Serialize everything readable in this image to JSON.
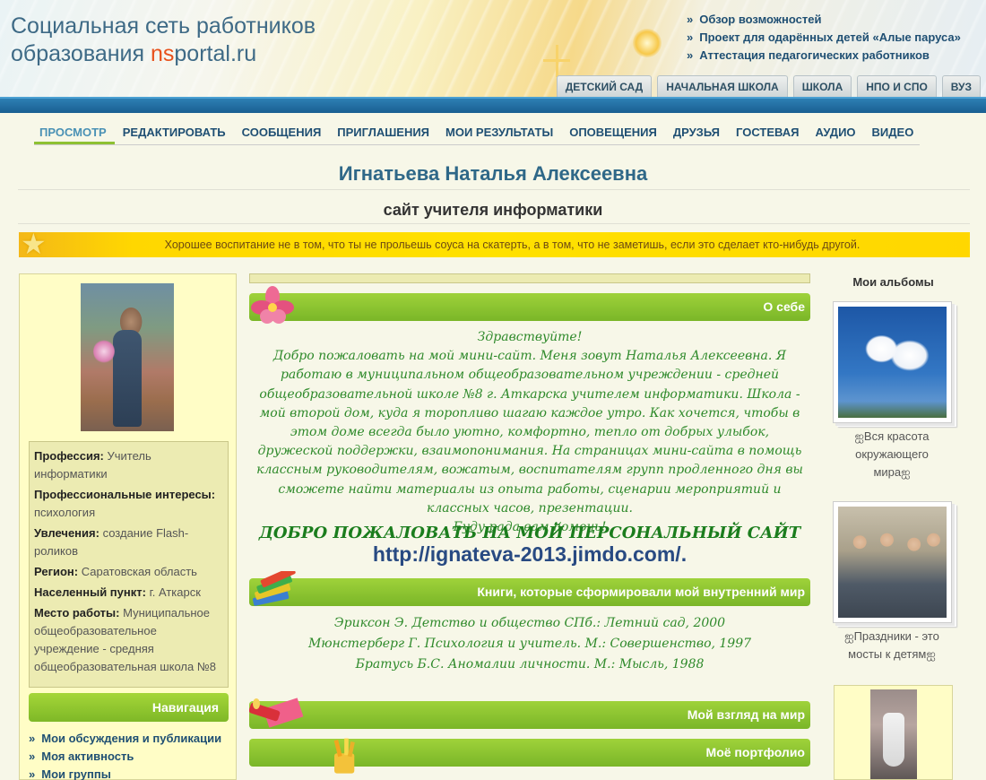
{
  "header": {
    "site_title_line1": "Социальная сеть работников",
    "site_title_line2_prefix": "образования ",
    "site_title_ns": "ns",
    "site_title_portal": "portal.ru",
    "top_links": [
      "Обзор возможностей",
      "Проект для одарённых детей «Алые паруса»",
      "Аттестация педагогических работников"
    ],
    "edu_tabs": [
      "ДЕТСКИЙ САД",
      "НАЧАЛЬНАЯ ШКОЛА",
      "ШКОЛА",
      "НПО И СПО",
      "ВУЗ"
    ],
    "bullet": "»"
  },
  "profile_nav": [
    "ПРОСМОТР",
    "РЕДАКТИРОВАТЬ",
    "СООБЩЕНИЯ",
    "ПРИГЛАШЕНИЯ",
    "МОИ РЕЗУЛЬТАТЫ",
    "ОПОВЕЩЕНИЯ",
    "ДРУЗЬЯ",
    "ГОСТЕВАЯ",
    "АУДИО",
    "ВИДЕО"
  ],
  "owner_name": "Игнатьева Наталья Алексеевна",
  "site_subtitle": "сайт учителя информатики",
  "quote": "Хорошее воспитание не в том, что ты не прольешь соуса на скатерть, а в том, что не заметишь, если это сделает кто-нибудь другой.",
  "star_glyph": "★",
  "profile": [
    {
      "label": "Профессия:",
      "value": "Учитель информатики"
    },
    {
      "label": "Профессиональные интересы:",
      "value": "психология"
    },
    {
      "label": "Увлечения:",
      "value": "создание Flash-роликов"
    },
    {
      "label": "Регион:",
      "value": "Саратовская область"
    },
    {
      "label": "Населенный пункт:",
      "value": "г. Аткарск"
    },
    {
      "label": "Место работы:",
      "value": "Муниципальное общеобразовательное учреждение - средняя общеобразовательная школа №8"
    }
  ],
  "navigation": {
    "title": "Навигация",
    "items": [
      "Мои обсуждения и публикации",
      "Моя активность",
      "Мои группы"
    ]
  },
  "sections": {
    "about": "О себе",
    "books": "Книги, которые сформировали мой внутренний мир",
    "worldview": "Мой взгляд на мир",
    "portfolio": "Моё портфолио"
  },
  "about_text": {
    "greeting": "Здравствуйте!",
    "body": "Добро пожаловать на мой мини-сайт. Меня зовут Наталья Алексеевна. Я работаю в муниципальном общеобразовательном учреждении - средней общеобразовательной школе №8 г. Аткарска учителем информатики. Школа - мой второй дом, куда я торопливо шагаю каждое утро. Как хочется, чтобы в этом доме всегда было уютно, комфортно, тепло от добрых улыбок, дружеской поддержки, взаимопонимания. На страницах мини-сайта в помощь классным руководителям, вожатым, воспитателям групп продленного дня вы сможете найти материалы из опыта работы,  сценарии мероприятий и классных часов, презентации.",
    "closing": "Буду рада вам помочь!",
    "welcome_big": "ДОБРО ПОЖАЛОВАТЬ НА МОЙ ПЕРСОНАЛЬНЫЙ САЙТ",
    "url": "http://ignateva-2013.jimdo.com/."
  },
  "books": [
    "Эриксон Э. Детство и общество СПб.: Летний сад, 2000",
    "Мюнстерберг Г. Психология и учитель. М.: Совершенство, 1997",
    "Братусь Б.С. Аномалии личности. М.: Мысль, 1988"
  ],
  "albums": {
    "title": "Мои альбомы",
    "items": [
      {
        "caption_lines": [
          "ஐВся красота",
          "окружающего",
          "мираஐ"
        ]
      },
      {
        "caption_lines": [
          "ஐПраздники - это",
          "мосты к детямஐ"
        ]
      }
    ]
  },
  "colors": {
    "accent_green": "#8ec132",
    "nav_blue": "#1f4f73",
    "italic_green": "#2f8a2b",
    "header_bar_blue": "#1a5f92",
    "ns_orange": "#e8511c"
  }
}
